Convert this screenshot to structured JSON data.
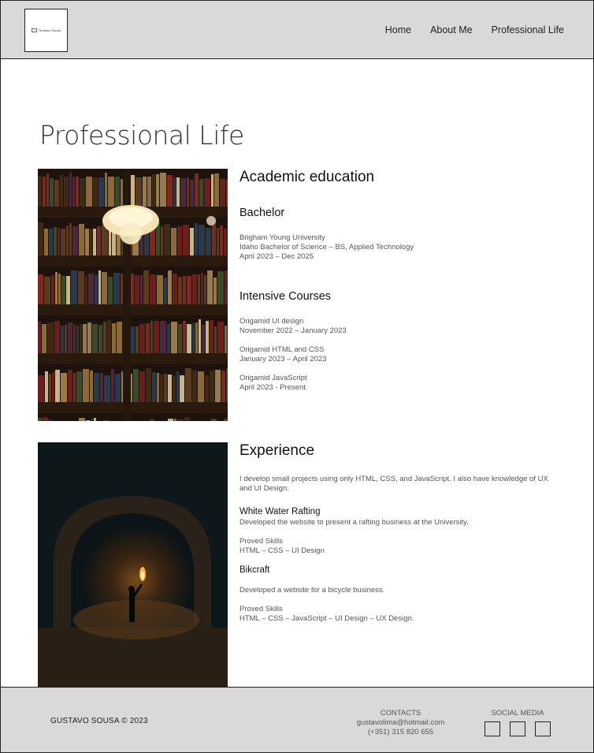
{
  "header": {
    "logo_text": "Gustavo Sousa",
    "nav": [
      "Home",
      "About Me",
      "Professional Life"
    ]
  },
  "page_title": "Professional Life",
  "education": {
    "title": "Academic education",
    "bachelor": {
      "title": "Bachelor",
      "lines": [
        "Brigham Young University",
        "Idaho Bachelor of Science – BS, Applied Technology",
        "April 2023 – Dec 2025"
      ]
    },
    "courses": {
      "title": "Intensive Courses",
      "items": [
        {
          "name": "Origamid UI design",
          "dates": "November 2022 – January 2023"
        },
        {
          "name": "Origamid HTML and CSS",
          "dates": "January 2023 – April 2023"
        },
        {
          "name": "Origamid JavaScript",
          "dates": "April 2023 - Present"
        }
      ]
    }
  },
  "experience": {
    "title": "Experience",
    "intro": "I develop small projects using only HTML, CSS, and JavaScript. I also have knowledge of UX and UI Design.",
    "projects": [
      {
        "name": "White Water Rafting",
        "desc": "Developed the website to present a rafting business at the University.",
        "skills_label": "Proved Skills",
        "skills": "HTML – CSS – UI Design"
      },
      {
        "name": "Bikcraft",
        "desc": "Developed a website for a bicycle business.",
        "skills_label": "Proved Skills",
        "skills": "HTML – CSS – JavaScript – UI Design – UX Design."
      }
    ]
  },
  "footer": {
    "copyright": "GUSTAVO SOUSA © 2023",
    "contacts_title": "CONTACTS",
    "email": "gustavolima@hotmail.com",
    "phone": "(+351) 315 820 655",
    "social_title": "SOCIAL MEDIA"
  }
}
